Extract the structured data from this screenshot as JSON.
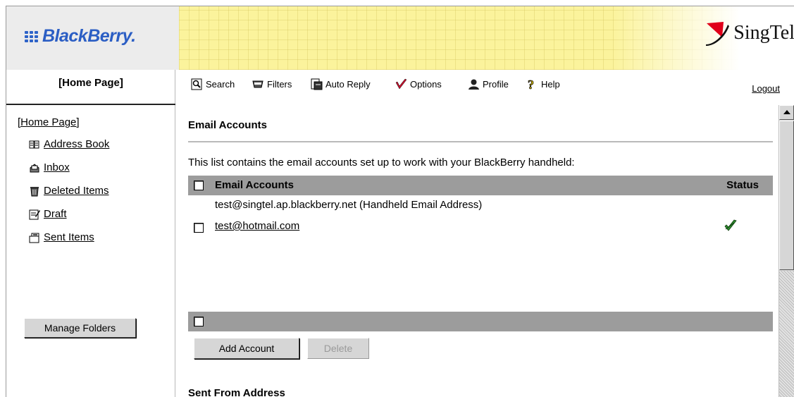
{
  "header": {
    "brand_logo": "BlackBerry.",
    "partner_logo": "SingTel"
  },
  "sidebar": {
    "title": "[Home Page]",
    "tree_home": "[Home Page]",
    "items": [
      {
        "label": "Address Book",
        "icon": "address-book-icon"
      },
      {
        "label": "Inbox",
        "icon": "inbox-icon"
      },
      {
        "label": "Deleted Items",
        "icon": "trash-icon"
      },
      {
        "label": "Draft",
        "icon": "draft-icon"
      },
      {
        "label": "Sent Items",
        "icon": "sent-items-icon"
      }
    ],
    "manage_button": "Manage Folders"
  },
  "toolbar": {
    "search": "Search",
    "filters": "Filters",
    "auto_reply": "Auto Reply",
    "options": "Options",
    "profile": "Profile",
    "help": "Help",
    "logout": "Logout"
  },
  "main": {
    "section_title": "Email Accounts",
    "description": "This list contains the email accounts set up to work with your BlackBerry handheld:",
    "table": {
      "col_accounts": "Email Accounts",
      "col_status": "Status",
      "rows": [
        {
          "account": "test@singtel.ap.blackberry.net  (Handheld Email Address)",
          "checkbox": false,
          "status": ""
        },
        {
          "account": "test@hotmail.com",
          "checkbox": true,
          "status": "check-icon"
        }
      ]
    },
    "add_button": "Add Account",
    "delete_button": "Delete",
    "next_section_title": "Sent From Address"
  },
  "colors": {
    "brand_blue": "#2b5ec4",
    "banner_yellow": "#fbf39c",
    "singtel_red": "#e0001a",
    "grid_header": "#9c9c9c",
    "status_green": "#2e8b2e"
  }
}
